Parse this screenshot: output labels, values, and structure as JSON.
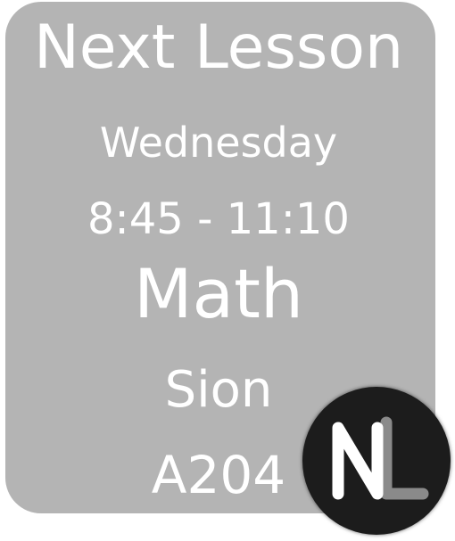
{
  "widget": {
    "title": "Next Lesson",
    "day": "Wednesday",
    "time": "8:45 - 11:10",
    "subject": "Math",
    "teacher": "Sion",
    "room": "A204"
  },
  "badge": {
    "icon": "nl-logo-icon",
    "colors": {
      "background": "#1c1c1c",
      "n_letter": "#ffffff",
      "l_letter": "#8a8a8a"
    }
  },
  "colors": {
    "card_background": "#b4b4b4",
    "text": "#ffffff"
  }
}
